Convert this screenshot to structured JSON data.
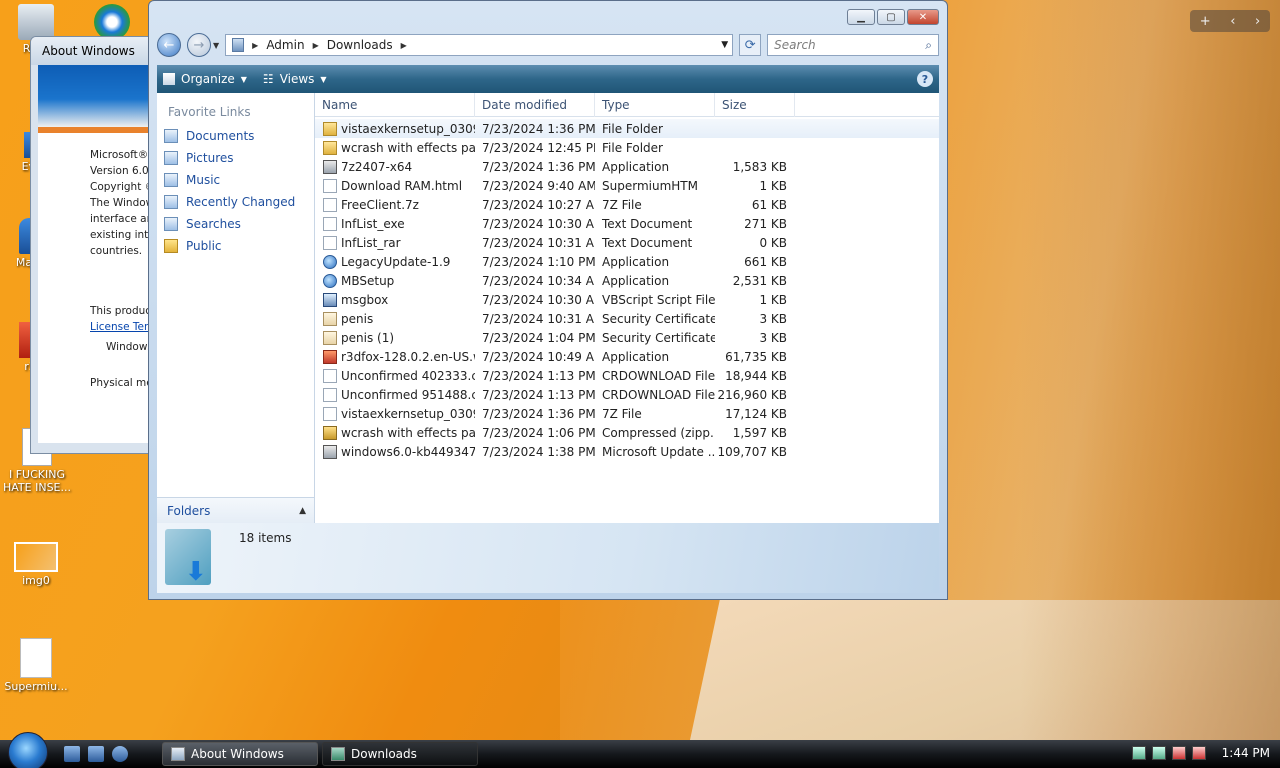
{
  "desktop": {
    "icons": [
      {
        "label": "Recy"
      },
      {
        "label": "Ever"
      },
      {
        "label": "Malw"
      },
      {
        "label": "r3"
      },
      {
        "label": "I FUCKING HATE INSE..."
      },
      {
        "label": "img0"
      },
      {
        "label": "Supermiu..."
      }
    ]
  },
  "about_window": {
    "title": "About Windows",
    "lines": [
      "Microsoft®",
      "Version 6.0",
      "Copyright ©",
      "The Window",
      "interface ar",
      "existing inte",
      "countries."
    ],
    "license_line": "This product",
    "license_link": "License Term",
    "windows_line": "Windows",
    "memory_line": "Physical mer"
  },
  "explorer": {
    "address": {
      "crumbs": [
        "Admin",
        "Downloads"
      ]
    },
    "search_placeholder": "Search",
    "toolbar": {
      "organize": "Organize",
      "views": "Views",
      "help": "?"
    },
    "nav": {
      "favorite_links_label": "Favorite Links",
      "items": [
        {
          "label": "Documents",
          "icon": "documents-icon"
        },
        {
          "label": "Pictures",
          "icon": "pictures-icon"
        },
        {
          "label": "Music",
          "icon": "music-icon"
        },
        {
          "label": "Recently Changed",
          "icon": "recent-icon"
        },
        {
          "label": "Searches",
          "icon": "searches-icon"
        },
        {
          "label": "Public",
          "icon": "folder-icon"
        }
      ],
      "folders_label": "Folders"
    },
    "columns": [
      "Name",
      "Date modified",
      "Type",
      "Size"
    ],
    "files": [
      {
        "name": "vistaexkernsetup_0309...",
        "date": "7/23/2024 1:36 PM",
        "type": "File Folder",
        "size": "",
        "icon": "folder"
      },
      {
        "name": "wcrash with effects pat...",
        "date": "7/23/2024 12:45 PM",
        "type": "File Folder",
        "size": "",
        "icon": "folder"
      },
      {
        "name": "7z2407-x64",
        "date": "7/23/2024 1:36 PM",
        "type": "Application",
        "size": "1,583 KB",
        "icon": "app"
      },
      {
        "name": "Download RAM.html",
        "date": "7/23/2024 9:40 AM",
        "type": "SupermiumHTM",
        "size": "1 KB",
        "icon": "doc"
      },
      {
        "name": "FreeClient.7z",
        "date": "7/23/2024 10:27 AM",
        "type": "7Z File",
        "size": "61 KB",
        "icon": "doc"
      },
      {
        "name": "InfList_exe",
        "date": "7/23/2024 10:30 AM",
        "type": "Text Document",
        "size": "271 KB",
        "icon": "doc"
      },
      {
        "name": "InfList_rar",
        "date": "7/23/2024 10:31 AM",
        "type": "Text Document",
        "size": "0 KB",
        "icon": "doc"
      },
      {
        "name": "LegacyUpdate-1.9",
        "date": "7/23/2024 1:10 PM",
        "type": "Application",
        "size": "661 KB",
        "icon": "globe"
      },
      {
        "name": "MBSetup",
        "date": "7/23/2024 10:34 AM",
        "type": "Application",
        "size": "2,531 KB",
        "icon": "globe"
      },
      {
        "name": "msgbox",
        "date": "7/23/2024 10:30 AM",
        "type": "VBScript Script File",
        "size": "1 KB",
        "icon": "vbs"
      },
      {
        "name": "penis",
        "date": "7/23/2024 10:31 AM",
        "type": "Security Certificate",
        "size": "3 KB",
        "icon": "cert"
      },
      {
        "name": "penis (1)",
        "date": "7/23/2024 1:04 PM",
        "type": "Security Certificate",
        "size": "3 KB",
        "icon": "cert"
      },
      {
        "name": "r3dfox-128.0.2.en-US.w...",
        "date": "7/23/2024 10:49 AM",
        "type": "Application",
        "size": "61,735 KB",
        "icon": "fox"
      },
      {
        "name": "Unconfirmed 402333.c...",
        "date": "7/23/2024 1:13 PM",
        "type": "CRDOWNLOAD File",
        "size": "18,944 KB",
        "icon": "doc"
      },
      {
        "name": "Unconfirmed 951488.c...",
        "date": "7/23/2024 1:13 PM",
        "type": "CRDOWNLOAD File",
        "size": "216,960 KB",
        "icon": "doc"
      },
      {
        "name": "vistaexkernsetup_0309...",
        "date": "7/23/2024 1:36 PM",
        "type": "7Z File",
        "size": "17,124 KB",
        "icon": "doc"
      },
      {
        "name": "wcrash with effects pat...",
        "date": "7/23/2024 1:06 PM",
        "type": "Compressed (zipp...",
        "size": "1,597 KB",
        "icon": "zip"
      },
      {
        "name": "windows6.0-kb449347...",
        "date": "7/23/2024 1:38 PM",
        "type": "Microsoft Update ...",
        "size": "109,707 KB",
        "icon": "app"
      }
    ],
    "status": {
      "item_count": "18 items"
    }
  },
  "taskbar": {
    "tasks": [
      {
        "label": "About Windows",
        "active": false
      },
      {
        "label": "Downloads",
        "active": true
      }
    ],
    "clock": "1:44 PM"
  }
}
